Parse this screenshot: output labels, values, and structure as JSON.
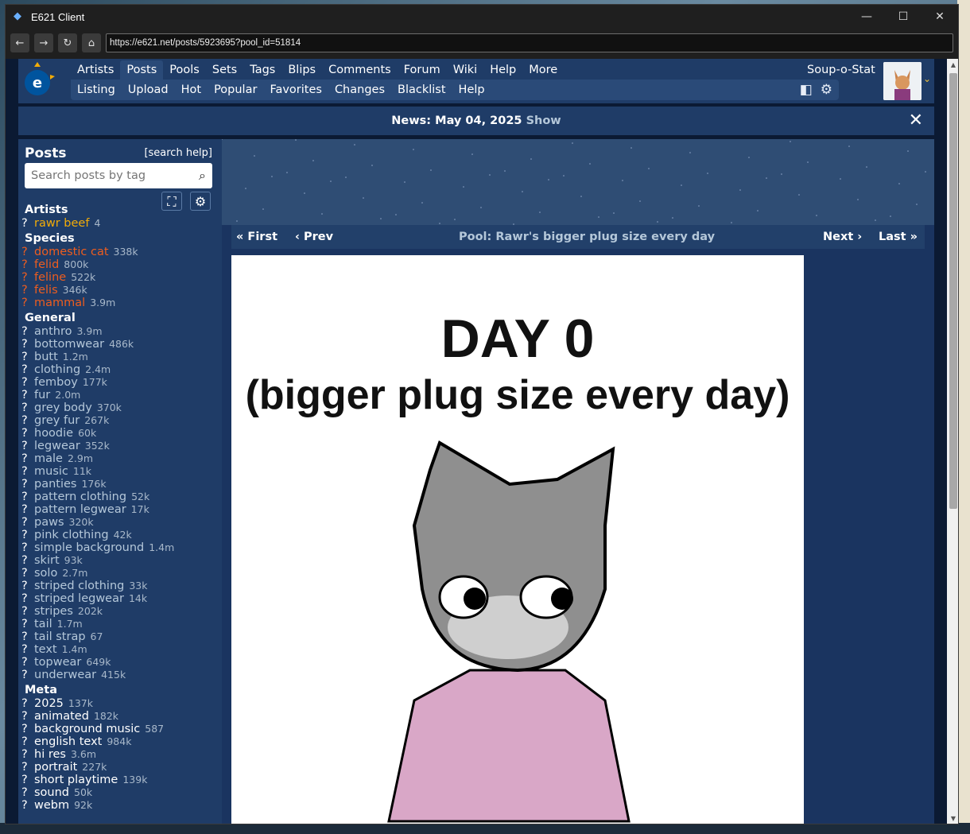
{
  "window": {
    "title": "E621 Client",
    "minimize": "—",
    "maximize": "☐",
    "close": "✕"
  },
  "toolbar": {
    "back": "←",
    "forward": "→",
    "reload": "↻",
    "home": "⌂",
    "url": "https://e621.net/posts/5923695?pool_id=51814"
  },
  "nav": {
    "primary": [
      "Artists",
      "Posts",
      "Pools",
      "Sets",
      "Tags",
      "Blips",
      "Comments",
      "Forum",
      "Wiki",
      "Help",
      "More"
    ],
    "secondary": [
      "Listing",
      "Upload",
      "Hot",
      "Popular",
      "Favorites",
      "Changes",
      "Blacklist",
      "Help"
    ],
    "user": "Soup-o-Stat"
  },
  "news": {
    "text": "News: May 04, 2025",
    "show": "Show",
    "close": "✕"
  },
  "sidebar": {
    "heading": "Posts",
    "search_help": "[search help]",
    "search_placeholder": "Search posts by tag",
    "categories": {
      "artists": "Artists",
      "species": "Species",
      "general": "General",
      "meta": "Meta"
    },
    "artists": [
      {
        "name": "rawr beef",
        "count": "4"
      }
    ],
    "species": [
      {
        "name": "domestic cat",
        "count": "338k"
      },
      {
        "name": "felid",
        "count": "800k"
      },
      {
        "name": "feline",
        "count": "522k"
      },
      {
        "name": "felis",
        "count": "346k"
      },
      {
        "name": "mammal",
        "count": "3.9m"
      }
    ],
    "general": [
      {
        "name": "anthro",
        "count": "3.9m"
      },
      {
        "name": "bottomwear",
        "count": "486k"
      },
      {
        "name": "butt",
        "count": "1.2m"
      },
      {
        "name": "clothing",
        "count": "2.4m"
      },
      {
        "name": "femboy",
        "count": "177k"
      },
      {
        "name": "fur",
        "count": "2.0m"
      },
      {
        "name": "grey body",
        "count": "370k"
      },
      {
        "name": "grey fur",
        "count": "267k"
      },
      {
        "name": "hoodie",
        "count": "60k"
      },
      {
        "name": "legwear",
        "count": "352k"
      },
      {
        "name": "male",
        "count": "2.9m"
      },
      {
        "name": "music",
        "count": "11k"
      },
      {
        "name": "panties",
        "count": "176k"
      },
      {
        "name": "pattern clothing",
        "count": "52k"
      },
      {
        "name": "pattern legwear",
        "count": "17k"
      },
      {
        "name": "paws",
        "count": "320k"
      },
      {
        "name": "pink clothing",
        "count": "42k"
      },
      {
        "name": "simple background",
        "count": "1.4m"
      },
      {
        "name": "skirt",
        "count": "93k"
      },
      {
        "name": "solo",
        "count": "2.7m"
      },
      {
        "name": "striped clothing",
        "count": "33k"
      },
      {
        "name": "striped legwear",
        "count": "14k"
      },
      {
        "name": "stripes",
        "count": "202k"
      },
      {
        "name": "tail",
        "count": "1.7m"
      },
      {
        "name": "tail strap",
        "count": "67"
      },
      {
        "name": "text",
        "count": "1.4m"
      },
      {
        "name": "topwear",
        "count": "649k"
      },
      {
        "name": "underwear",
        "count": "415k"
      }
    ],
    "meta": [
      {
        "name": "2025",
        "count": "137k"
      },
      {
        "name": "animated",
        "count": "182k"
      },
      {
        "name": "background music",
        "count": "587"
      },
      {
        "name": "english text",
        "count": "984k"
      },
      {
        "name": "hi res",
        "count": "3.6m"
      },
      {
        "name": "portrait",
        "count": "227k"
      },
      {
        "name": "short playtime",
        "count": "139k"
      },
      {
        "name": "sound",
        "count": "50k"
      },
      {
        "name": "webm",
        "count": "92k"
      }
    ]
  },
  "pool": {
    "first": "« First",
    "prev": "‹ Prev",
    "name": "Pool: Rawr's bigger plug size every day",
    "next": "Next ›",
    "last": "Last »"
  },
  "post": {
    "title": "DAY 0",
    "subtitle": "(bigger plug size every day)"
  },
  "colors": {
    "header": "#1f3c67",
    "nav_secondary": "#2a4a78",
    "artist_tag": "#f2ac08",
    "species_tag": "#ed5d1f",
    "general_tag": "#b4c7d9"
  }
}
